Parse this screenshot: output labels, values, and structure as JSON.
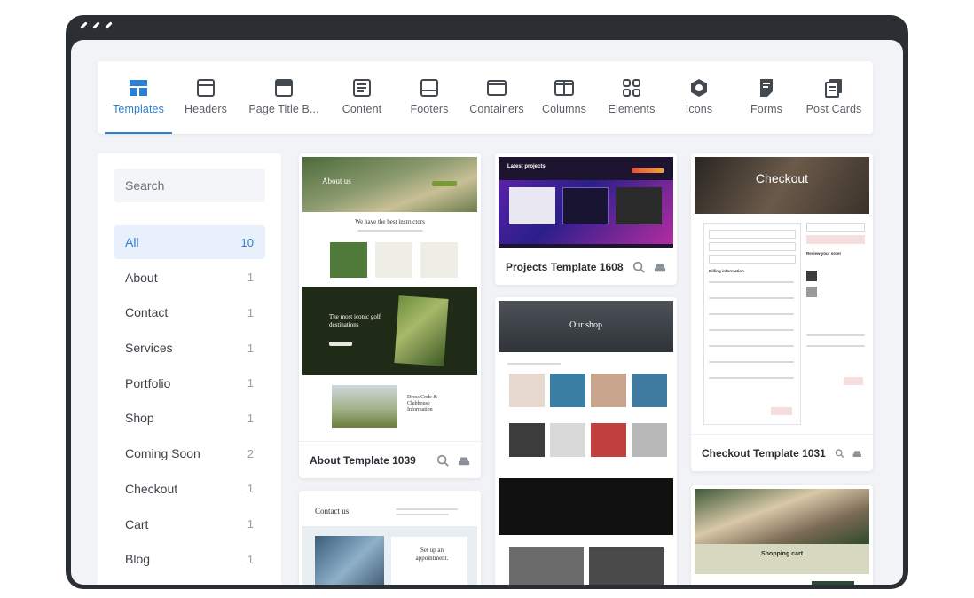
{
  "toolbar": {
    "tabs": [
      {
        "label": "Templates",
        "icon": "templates-icon",
        "active": true
      },
      {
        "label": "Headers",
        "icon": "headers-icon"
      },
      {
        "label": "Page Title B...",
        "icon": "page-title-icon"
      },
      {
        "label": "Content",
        "icon": "content-icon"
      },
      {
        "label": "Footers",
        "icon": "footers-icon"
      },
      {
        "label": "Containers",
        "icon": "containers-icon"
      },
      {
        "label": "Columns",
        "icon": "columns-icon"
      },
      {
        "label": "Elements",
        "icon": "elements-icon"
      },
      {
        "label": "Icons",
        "icon": "icons-icon"
      },
      {
        "label": "Forms",
        "icon": "forms-icon"
      },
      {
        "label": "Post Cards",
        "icon": "post-cards-icon"
      }
    ]
  },
  "sidebar": {
    "search_placeholder": "Search",
    "categories": [
      {
        "label": "All",
        "count": "10"
      },
      {
        "label": "About",
        "count": "1"
      },
      {
        "label": "Contact",
        "count": "1"
      },
      {
        "label": "Services",
        "count": "1"
      },
      {
        "label": "Portfolio",
        "count": "1"
      },
      {
        "label": "Shop",
        "count": "1"
      },
      {
        "label": "Coming Soon",
        "count": "2"
      },
      {
        "label": "Checkout",
        "count": "1"
      },
      {
        "label": "Cart",
        "count": "1"
      },
      {
        "label": "Blog",
        "count": "1"
      }
    ]
  },
  "cards": {
    "about": {
      "title": "About Template 1039",
      "hero": "About us",
      "heading": "We have the best instructors",
      "dark_heading": "The most iconic golf destinations",
      "dress_heading": "Dress Code & Clubhouse Information"
    },
    "projects": {
      "title": "Projects Template 1608",
      "hero": "Latest projects"
    },
    "checkout": {
      "title": "Checkout Template 1031",
      "hero": "Checkout",
      "billing": "Billing information",
      "order": "Review your order"
    },
    "contact": {
      "hero": "Contact us",
      "appointment": "Set up an appointment."
    },
    "shop": {
      "hero": "Our shop"
    },
    "cart": {
      "hero": "Shopping cart"
    }
  },
  "colors": {
    "accent": "#2d7fd2",
    "frame": "#2b2f34",
    "canvas": "#f1f3f6"
  }
}
